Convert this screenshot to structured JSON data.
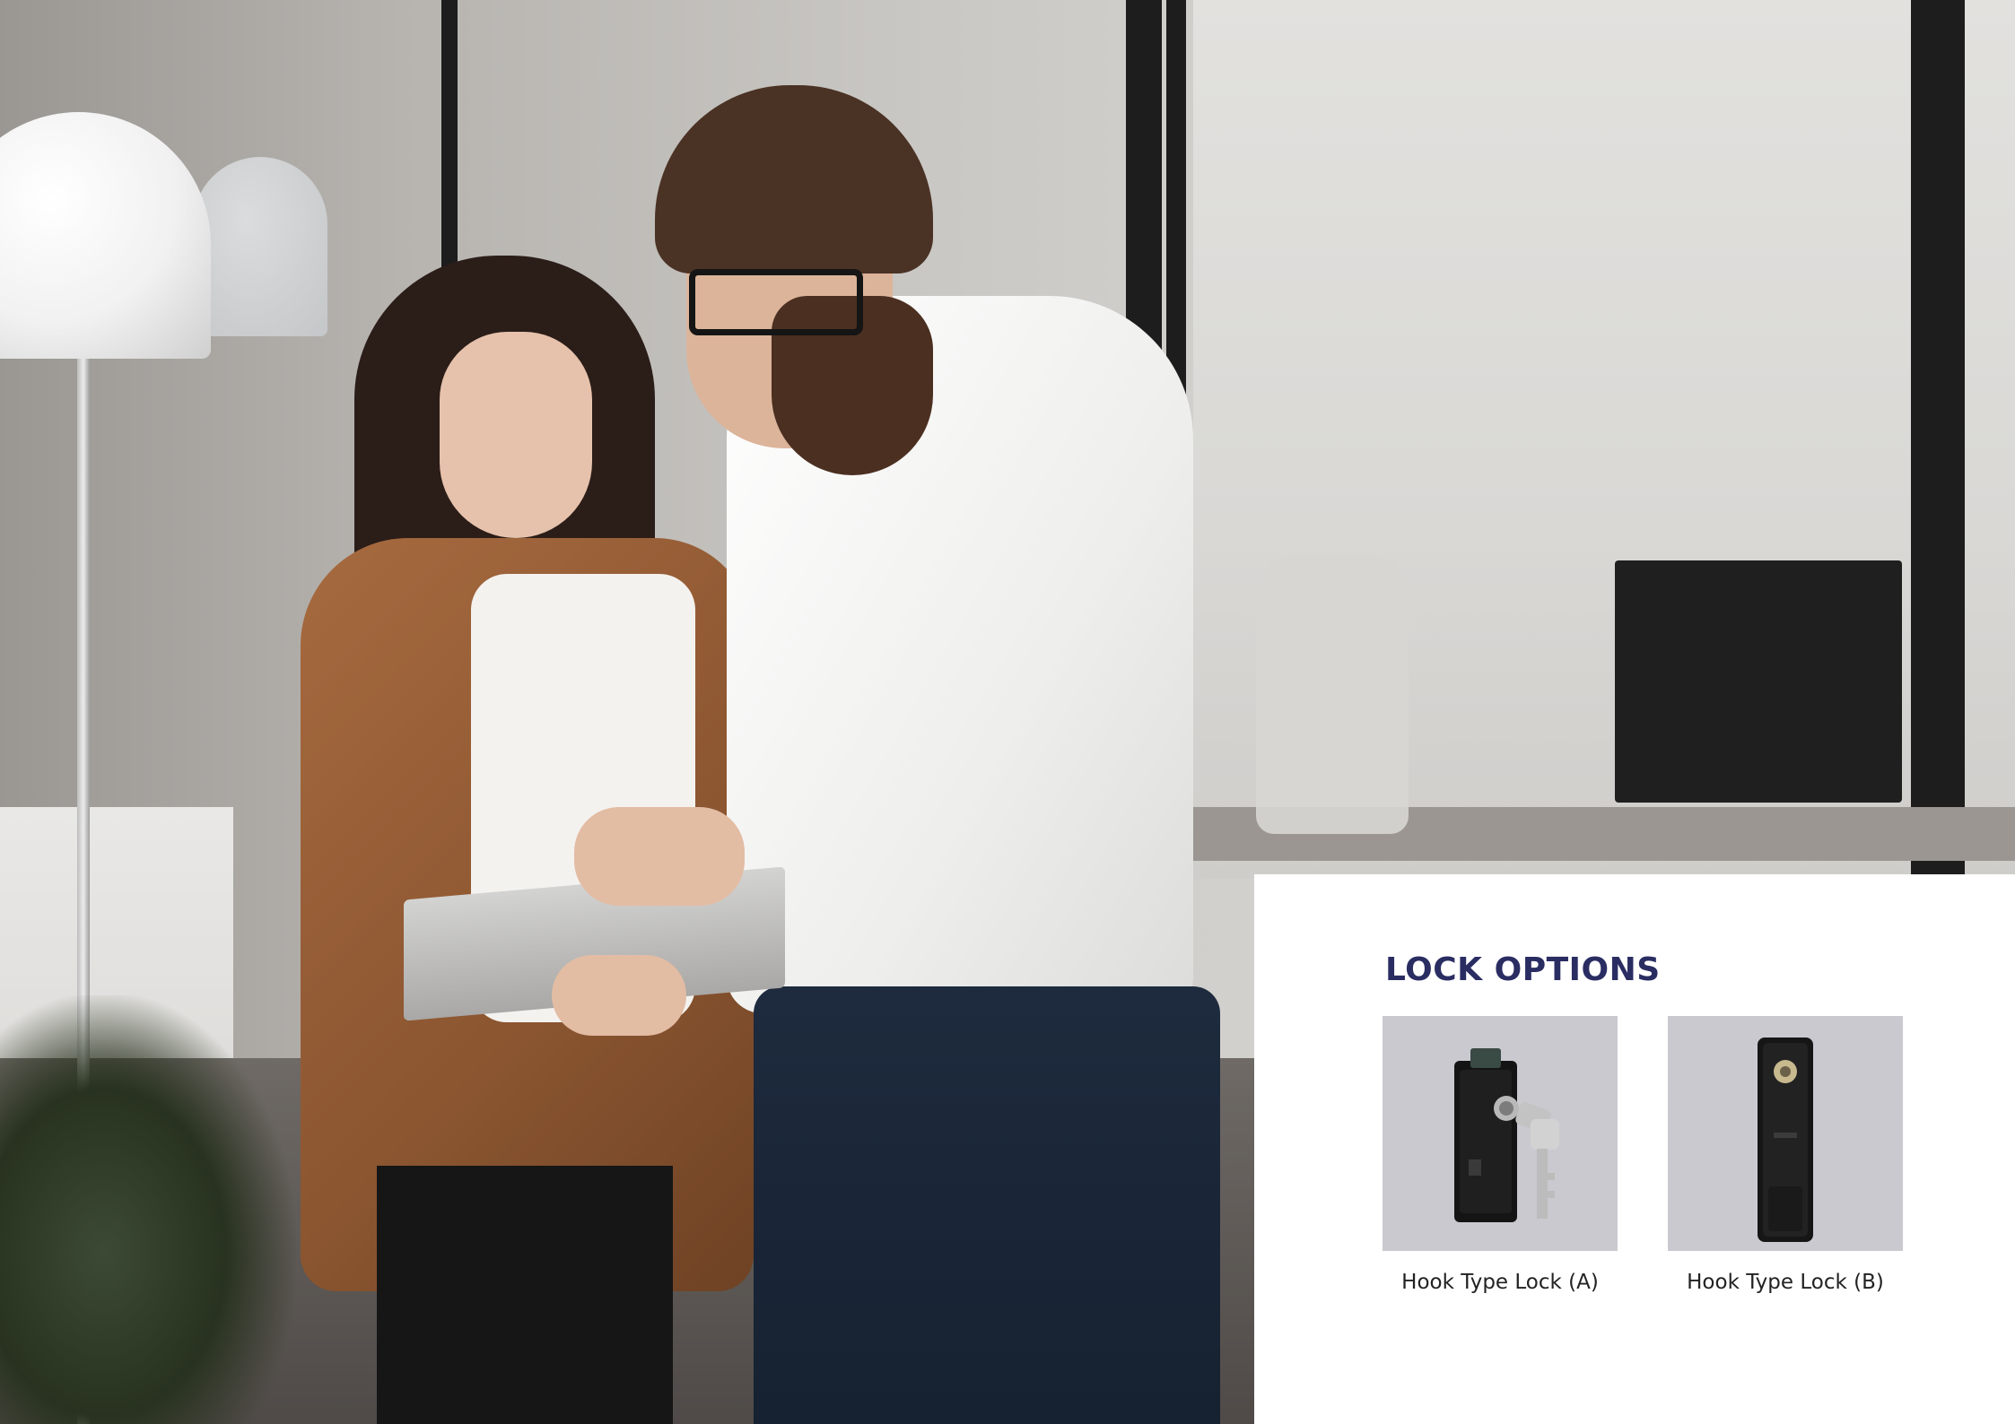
{
  "lock_options": {
    "title": "LOCK OPTIONS",
    "items": [
      {
        "label": "Hook Type Lock (A)",
        "icon": "hook-lock-a-icon"
      },
      {
        "label": "Hook Type Lock (B)",
        "icon": "hook-lock-b-icon"
      }
    ]
  },
  "colors": {
    "title": "#2a2d62",
    "tile_background": "#cac9d0",
    "panel_background": "#ffffff"
  }
}
